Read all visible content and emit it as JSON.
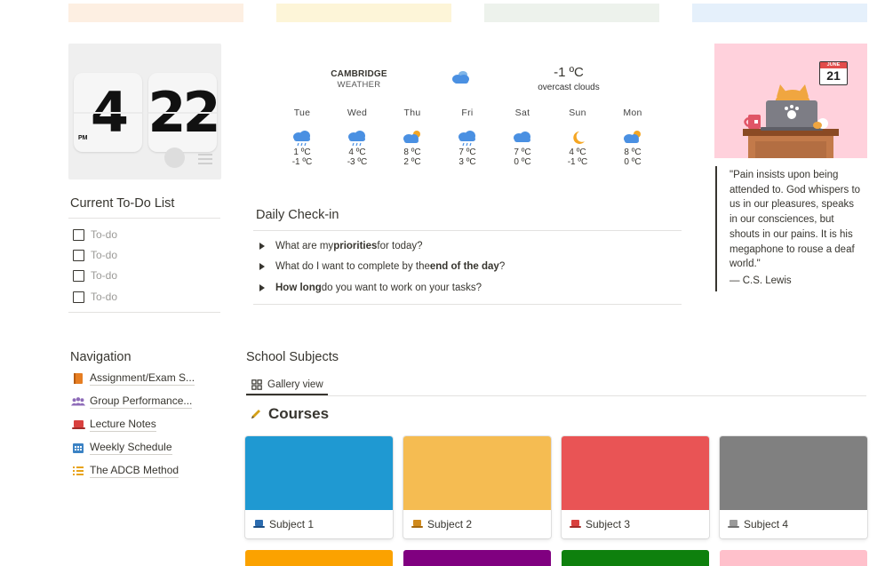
{
  "colors": {
    "bands": [
      "#fdefe2",
      "#fdf5d8",
      "#edf2ec",
      "#e5f0fb"
    ],
    "cover_blue": "#1f99d2",
    "cover_yellow": "#f5bc52",
    "cover_red": "#e95455",
    "cover_gray": "#808080",
    "next_orange": "#fba200",
    "next_purple": "#800080",
    "next_green": "#0e800d",
    "next_pink": "#ffc0cb",
    "cat_bg": "#ffd1dc"
  },
  "clock": {
    "hours": "4",
    "minutes": "22",
    "ampm": "PM"
  },
  "weather": {
    "city": "CAMBRIDGE",
    "subtitle": "WEATHER",
    "current_temp": "-1 ºC",
    "current_desc": "overcast clouds",
    "days": [
      {
        "name": "Tue",
        "hi": "1 ºC",
        "lo": "-1 ºC",
        "icon": "rain-cloud-icon"
      },
      {
        "name": "Wed",
        "hi": "4 ºC",
        "lo": "-3 ºC",
        "icon": "rain-cloud-icon"
      },
      {
        "name": "Thu",
        "hi": "8 ºC",
        "lo": "2 ºC",
        "icon": "cloud-sun-icon"
      },
      {
        "name": "Fri",
        "hi": "7 ºC",
        "lo": "3 ºC",
        "icon": "rain-cloud-icon"
      },
      {
        "name": "Sat",
        "hi": "7 ºC",
        "lo": "0 ºC",
        "icon": "cloud-icon"
      },
      {
        "name": "Sun",
        "hi": "4 ºC",
        "lo": "-1 ºC",
        "icon": "moon-icon"
      },
      {
        "name": "Mon",
        "hi": "8 ºC",
        "lo": "0 ºC",
        "icon": "cloud-sun-icon"
      }
    ]
  },
  "todo": {
    "title": "Current To-Do List",
    "items": [
      "To-do",
      "To-do",
      "To-do",
      "To-do"
    ]
  },
  "checkin": {
    "title": "Daily Check-in",
    "q1": {
      "pre": "What are my ",
      "bold": "priorities",
      "post": " for today?"
    },
    "q2": {
      "pre": "What do I want to complete by the ",
      "bold": "end of the day",
      "post": "?"
    },
    "q3": {
      "pre": "",
      "bold": "How long",
      "post": " do you want to work on your tasks?"
    }
  },
  "calendar": {
    "month": "JUNE",
    "day": "21"
  },
  "quote": {
    "text": "\"Pain insists upon being attended to. God whispers to us in our pleasures, speaks in our consciences, but shouts in our pains. It is his megaphone to rouse a deaf world.\"",
    "author": "— C.S. Lewis"
  },
  "navigation": {
    "title": "Navigation",
    "items": [
      {
        "label": "Assignment/Exam S...",
        "icon": "book-icon"
      },
      {
        "label": "Group Performance...",
        "icon": "people-icon"
      },
      {
        "label": "Lecture Notes",
        "icon": "laptop-icon"
      },
      {
        "label": "Weekly Schedule",
        "icon": "calendar-icon"
      },
      {
        "label": "The ADCB Method",
        "icon": "list-icon"
      }
    ]
  },
  "subjects": {
    "title": "School Subjects",
    "view_tab": "Gallery view",
    "section_title": "Courses",
    "cards": [
      "Subject 1",
      "Subject 2",
      "Subject 3",
      "Subject 4"
    ]
  }
}
